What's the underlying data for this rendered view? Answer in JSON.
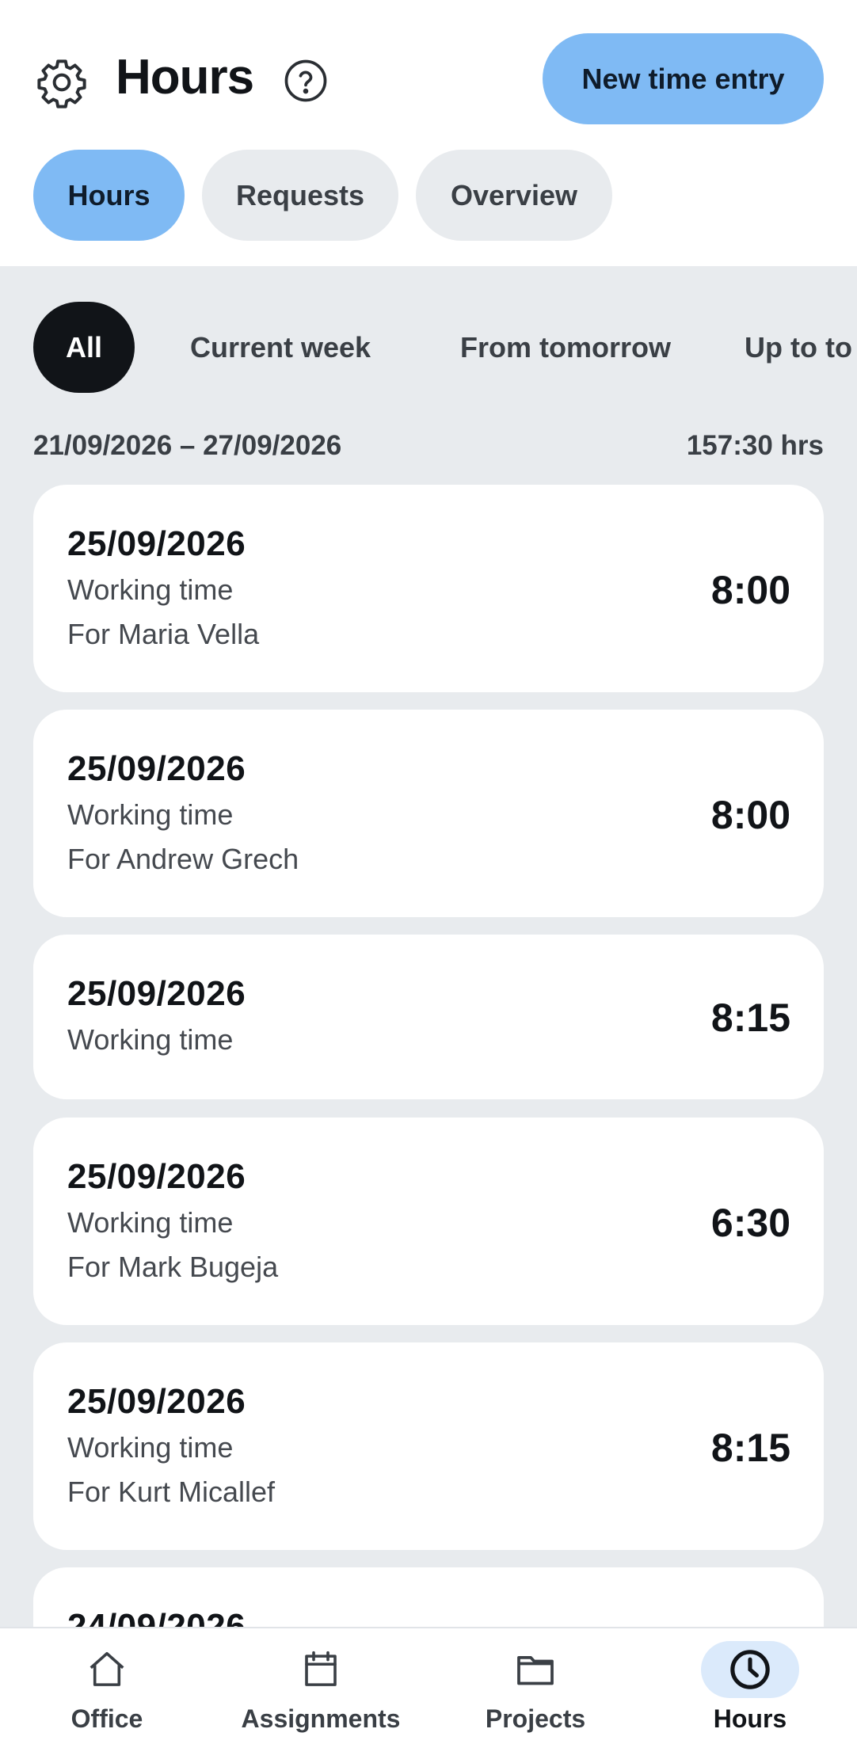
{
  "header": {
    "title": "Hours",
    "new_entry_label": "New time entry",
    "settings_icon": "gear-icon",
    "help_icon": "question-circle-icon"
  },
  "tabs": [
    {
      "label": "Hours",
      "active": true
    },
    {
      "label": "Requests",
      "active": false
    },
    {
      "label": "Overview",
      "active": false
    }
  ],
  "filters": [
    {
      "label": "All",
      "active": true
    },
    {
      "label": "Current week",
      "active": false
    },
    {
      "label": "From tomorrow",
      "active": false
    },
    {
      "label": "Up to to",
      "active": false
    }
  ],
  "week": {
    "range": "21/09/2026 – 27/09/2026",
    "total": "157:30 hrs"
  },
  "entries": [
    {
      "date": "25/09/2026",
      "type": "Working time",
      "who": "For Maria Vella",
      "duration": "8:00"
    },
    {
      "date": "25/09/2026",
      "type": "Working time",
      "who": "For Andrew Grech",
      "duration": "8:00"
    },
    {
      "date": "25/09/2026",
      "type": "Working time",
      "who": "",
      "duration": "8:15"
    },
    {
      "date": "25/09/2026",
      "type": "Working time",
      "who": "For Mark Bugeja",
      "duration": "6:30"
    },
    {
      "date": "25/09/2026",
      "type": "Working time",
      "who": "For Kurt Micallef",
      "duration": "8:15"
    },
    {
      "date": "24/09/2026",
      "type": "",
      "who": "",
      "duration": ""
    }
  ],
  "nav": [
    {
      "label": "Office",
      "icon": "home-icon",
      "active": false
    },
    {
      "label": "Assignments",
      "icon": "calendar-icon",
      "active": false
    },
    {
      "label": "Projects",
      "icon": "folder-icon",
      "active": false
    },
    {
      "label": "Hours",
      "icon": "clock-icon",
      "active": true
    }
  ],
  "colors": {
    "accent": "#7fbaf4",
    "active_filter": "#111418",
    "background": "#e8ebee"
  }
}
